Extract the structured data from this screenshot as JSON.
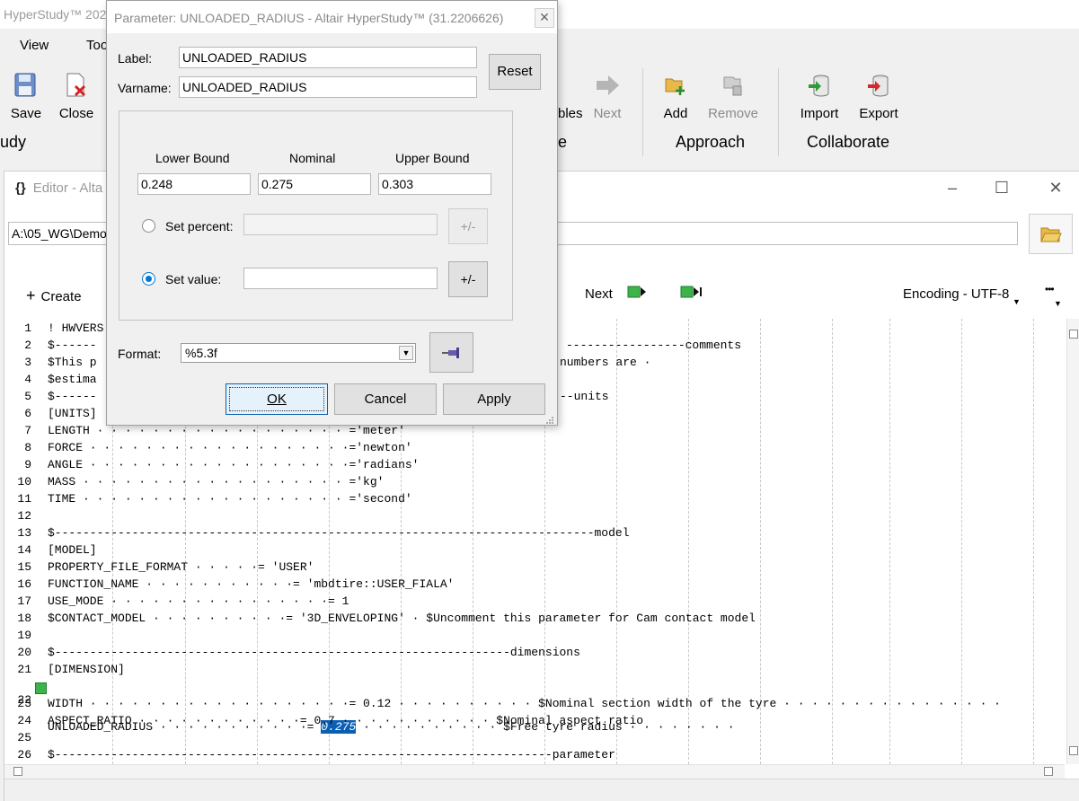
{
  "main": {
    "title": "HyperStudy™ 202",
    "menu": {
      "view": "View",
      "tools": "Too"
    },
    "ribbon": {
      "save": "Save",
      "close": "Close",
      "bles": "bles",
      "next": "Next",
      "add": "Add",
      "remove": "Remove",
      "import": "Import",
      "export": "Export",
      "group_study": "udy",
      "group_e": "e",
      "group_approach": "Approach",
      "group_collaborate": "Collaborate"
    }
  },
  "editor": {
    "title": "Editor - Alta",
    "path": "A:\\05_WG\\Demo",
    "create": "Create",
    "next": "Next",
    "encoding": "Encoding - UTF-8",
    "more": "•••",
    "lines": [
      {
        "n": "1",
        "t": "! HWVERS"
      },
      {
        "n": "2",
        "t": "$------"
      },
      {
        "n": "3",
        "t": "$This p"
      },
      {
        "n": "4",
        "t": "$estima"
      },
      {
        "n": "5",
        "t": "$------"
      },
      {
        "n": "6",
        "t": "[UNITS]"
      },
      {
        "n": "7",
        "t": "LENGTH · · · · · · · · · · · · · · · · · · ='meter'"
      },
      {
        "n": "8",
        "t": "FORCE · · · · · · · · · · · · · · · · · · ·='newton'"
      },
      {
        "n": "9",
        "t": "ANGLE · · · · · · · · · · · · · · · · · · ·='radians'"
      },
      {
        "n": "10",
        "t": "MASS · · · · · · · · · · · · · · · · · · · ='kg'"
      },
      {
        "n": "11",
        "t": "TIME · · · · · · · · · · · · · · · · · · · ='second'"
      },
      {
        "n": "12",
        "t": ""
      },
      {
        "n": "13",
        "t": "$-----------------------------------------------------------------------------model"
      },
      {
        "n": "14",
        "t": "[MODEL]"
      },
      {
        "n": "15",
        "t": "PROPERTY_FILE_FORMAT · · · · ·= 'USER'"
      },
      {
        "n": "16",
        "t": "FUNCTION_NAME · · · · · · · · · · ·= 'mbdtire::USER_FIALA'"
      },
      {
        "n": "17",
        "t": "USE_MODE · · · · · · · · · · · · · · · ·= 1"
      },
      {
        "n": "18",
        "t": "$CONTACT_MODEL · · · · · · · · · ·= '3D_ENVELOPING' · $Uncomment this parameter for Cam contact model"
      },
      {
        "n": "19",
        "t": ""
      },
      {
        "n": "20",
        "t": "$-----------------------------------------------------------------dimensions"
      },
      {
        "n": "21",
        "t": "[DIMENSION]"
      },
      {
        "n": "22",
        "t_before": "UNLOADED_RADIUS · · · · · · · · · · ·= ",
        "t_hl": "0.275",
        "t_after": " · · · · · · · · · · $Free tyre radius · · · · · · · ·"
      },
      {
        "n": "23",
        "t": "WIDTH · · · · · · · · · · · · · · · · · · ·= 0.12 · · · · · · · · · · $Nominal section width of the tyre · · · · · · · · · · · · · · · ·"
      },
      {
        "n": "24",
        "t": "ASPECT_RATIO · · · · · · · · · · · ·= 0.7 · · · · · · · · · · · $Nominal aspect ratio"
      },
      {
        "n": "25",
        "t": ""
      },
      {
        "n": "26",
        "t": "$-----------------------------------------------------------------------parameter"
      }
    ],
    "comments_frag": "-----------------comments",
    "numbers_frag": "numbers are ·",
    "units_frag": "--units"
  },
  "dialog": {
    "title": "Parameter: UNLOADED_RADIUS - Altair HyperStudy™ (31.2206626)",
    "close": "✕",
    "label_lbl": "Label:",
    "label_val": "UNLOADED_RADIUS",
    "varname_lbl": "Varname:",
    "varname_val": "UNLOADED_RADIUS",
    "reset": "Reset",
    "lower_lbl": "Lower Bound",
    "nominal_lbl": "Nominal",
    "upper_lbl": "Upper Bound",
    "lower_val": "0.248",
    "nominal_val": "0.275",
    "upper_val": "0.303",
    "set_percent": "Set percent:",
    "set_value": "Set value:",
    "pm": "+/-",
    "format_lbl": "Format:",
    "format_val": "%5.3f",
    "ok": "OK",
    "cancel": "Cancel",
    "apply": "Apply"
  }
}
